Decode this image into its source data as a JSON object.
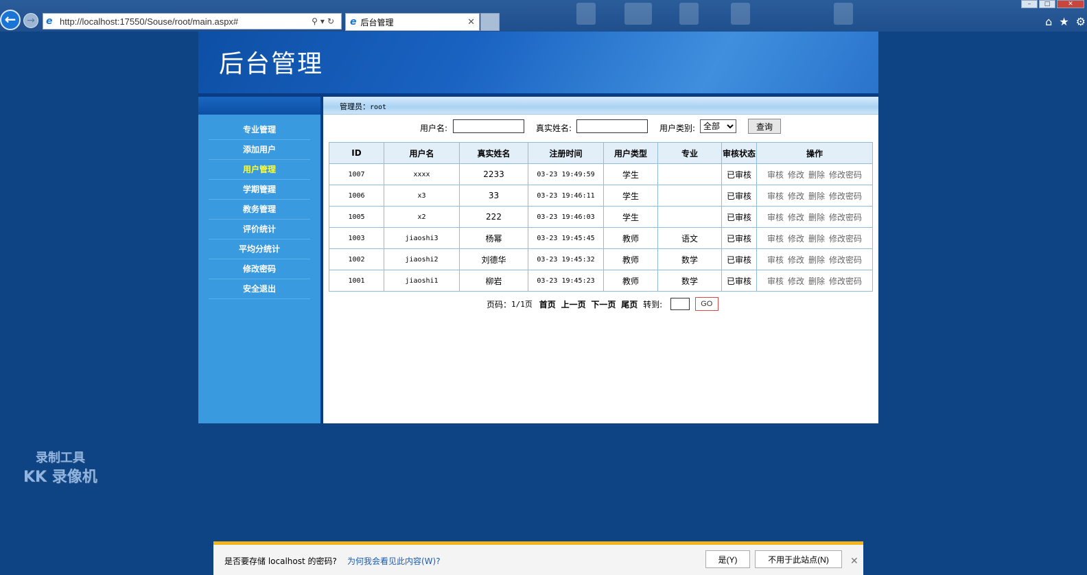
{
  "browser": {
    "url": "http://localhost:17550/Souse/root/main.aspx#",
    "tab_title": "后台管理"
  },
  "banner": {
    "title": "后台管理"
  },
  "sidebar": {
    "items": [
      {
        "label": "专业管理"
      },
      {
        "label": "添加用户"
      },
      {
        "label": "用户管理"
      },
      {
        "label": "学期管理"
      },
      {
        "label": "教务管理"
      },
      {
        "label": "评价统计"
      },
      {
        "label": "平均分统计"
      },
      {
        "label": "修改密码"
      },
      {
        "label": "安全退出"
      }
    ],
    "active_index": 2
  },
  "main": {
    "admin_label": "管理员：",
    "admin_name": "root",
    "search": {
      "username_label": "用户名:",
      "username_value": "",
      "realname_label": "真实姓名:",
      "realname_value": "",
      "type_label": "用户类别:",
      "type_selected": "全部",
      "query_button": "查询"
    },
    "table": {
      "headers": [
        "ID",
        "用户名",
        "真实姓名",
        "注册时间",
        "用户类型",
        "专业",
        "审核状态",
        "操作"
      ],
      "rows": [
        {
          "id": "1007",
          "username": "xxxx",
          "realname": "2233",
          "time": "03-23 19:49:59",
          "type": "学生",
          "major": "",
          "status": "已审核"
        },
        {
          "id": "1006",
          "username": "x3",
          "realname": "33",
          "time": "03-23 19:46:11",
          "type": "学生",
          "major": "",
          "status": "已审核"
        },
        {
          "id": "1005",
          "username": "x2",
          "realname": "222",
          "time": "03-23 19:46:03",
          "type": "学生",
          "major": "",
          "status": "已审核"
        },
        {
          "id": "1003",
          "username": "jiaoshi3",
          "realname": "杨幂",
          "time": "03-23 19:45:45",
          "type": "教师",
          "major": "语文",
          "status": "已审核"
        },
        {
          "id": "1002",
          "username": "jiaoshi2",
          "realname": "刘德华",
          "time": "03-23 19:45:32",
          "type": "教师",
          "major": "数学",
          "status": "已审核"
        },
        {
          "id": "1001",
          "username": "jiaoshi1",
          "realname": "柳岩",
          "time": "03-23 19:45:23",
          "type": "教师",
          "major": "数学",
          "status": "已审核"
        }
      ],
      "ops": [
        "审核",
        "修改",
        "删除",
        "修改密码"
      ]
    },
    "pager": {
      "page_label": "页码：",
      "page_value": "1/1页",
      "first": "首页",
      "prev": "上一页",
      "next": "下一页",
      "last": "尾页",
      "goto_label": "转到:",
      "go_button": "GO"
    }
  },
  "watermark": {
    "line1": "录制工具",
    "line2": "KK 录像机"
  },
  "notification": {
    "question": "是否要存储 localhost 的密码?",
    "why_link": "为何我会看见此内容(W)?",
    "yes_button": "是(Y)",
    "never_button": "不用于此站点(N)"
  },
  "colors": {
    "accent_active_menu": "#ffff33",
    "page_bg": "#0e4483",
    "notify_bar": "#f2b41b"
  }
}
